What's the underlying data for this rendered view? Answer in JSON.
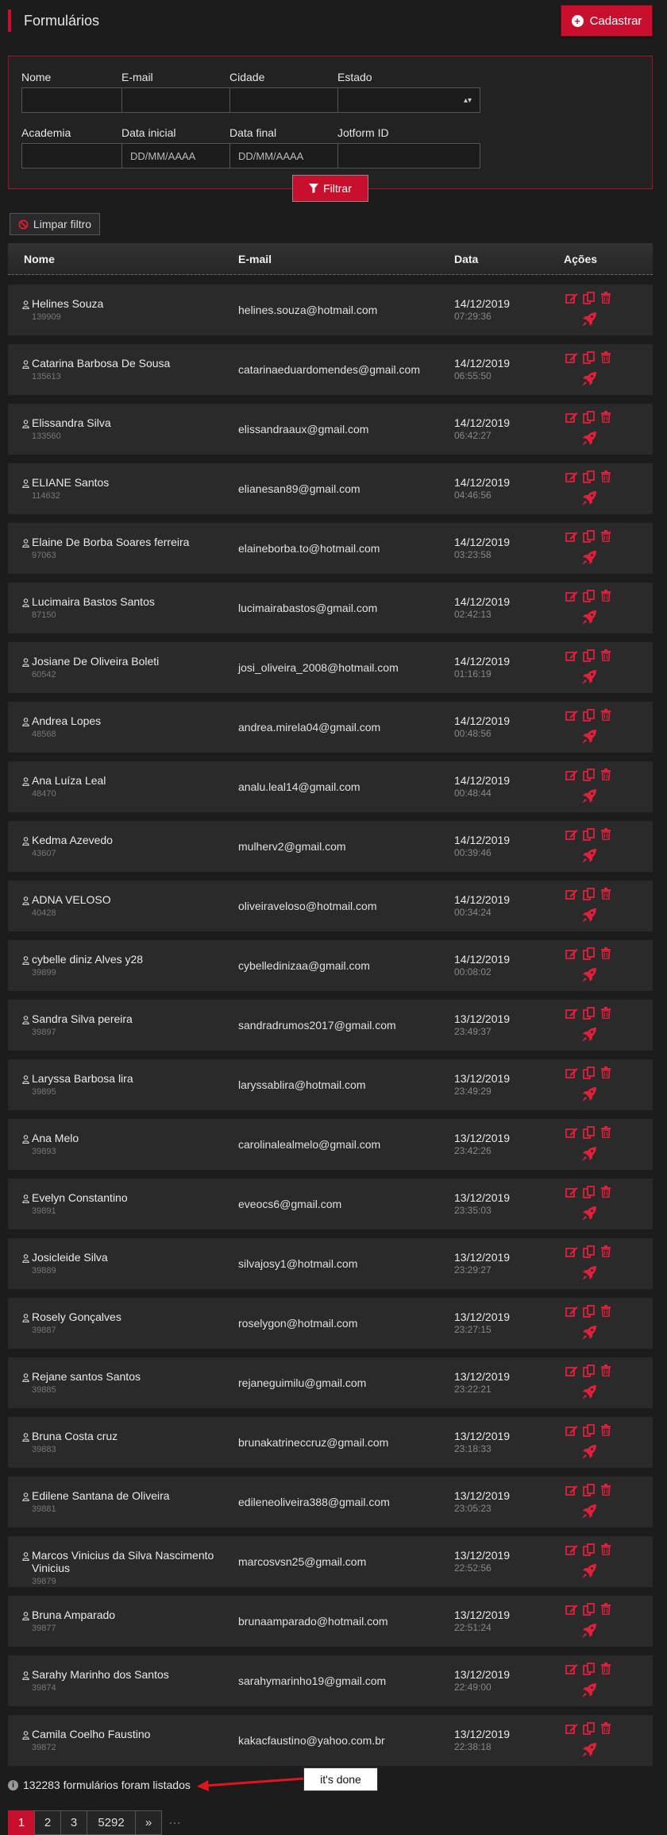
{
  "header": {
    "title": "Formulários",
    "cadastrar_label": "Cadastrar"
  },
  "filters": {
    "nome_label": "Nome",
    "nome_value": "",
    "email_label": "E-mail",
    "email_value": "",
    "cidade_label": "Cidade",
    "cidade_value": "",
    "estado_label": "Estado",
    "estado_value": "",
    "academia_label": "Academia",
    "academia_value": "",
    "data_inicial_label": "Data inicial",
    "data_inicial_placeholder": "DD/MM/AAAA",
    "data_final_label": "Data final",
    "data_final_placeholder": "DD/MM/AAAA",
    "jotform_label": "Jotform ID",
    "jotform_value": "",
    "filtrar_label": "Filtrar",
    "limpar_label": "Limpar filtro"
  },
  "table": {
    "headers": {
      "nome": "Nome",
      "email": "E-mail",
      "data": "Data",
      "acoes": "Ações"
    },
    "rows": [
      {
        "name": "Helines Souza",
        "id": "139909",
        "email": "helines.souza@hotmail.com",
        "date": "14/12/2019",
        "time": "07:29:36"
      },
      {
        "name": "Catarina Barbosa De Sousa",
        "id": "135613",
        "email": "catarinaeduardomendes@gmail.com",
        "date": "14/12/2019",
        "time": "06:55:50"
      },
      {
        "name": "Elissandra Silva",
        "id": "133560",
        "email": "elissandraaux@gmail.com",
        "date": "14/12/2019",
        "time": "06:42:27"
      },
      {
        "name": "ELIANE Santos",
        "id": "114632",
        "email": "elianesan89@gmail.com",
        "date": "14/12/2019",
        "time": "04:46:56"
      },
      {
        "name": "Elaine De Borba Soares ferreira",
        "id": "97063",
        "email": "elaineborba.to@hotmail.com",
        "date": "14/12/2019",
        "time": "03:23:58"
      },
      {
        "name": "Lucimaira Bastos Santos",
        "id": "87150",
        "email": "lucimairabastos@gmail.com",
        "date": "14/12/2019",
        "time": "02:42:13"
      },
      {
        "name": "Josiane De Oliveira Boleti",
        "id": "60542",
        "email": "josi_oliveira_2008@hotmail.com",
        "date": "14/12/2019",
        "time": "01:16:19"
      },
      {
        "name": "Andrea Lopes",
        "id": "48568",
        "email": "andrea.mirela04@gmail.com",
        "date": "14/12/2019",
        "time": "00:48:56"
      },
      {
        "name": "Ana Luíza Leal",
        "id": "48470",
        "email": "analu.leal14@gmail.com",
        "date": "14/12/2019",
        "time": "00:48:44"
      },
      {
        "name": "Kedma Azevedo",
        "id": "43607",
        "email": "mulherv2@gmail.com",
        "date": "14/12/2019",
        "time": "00:39:46"
      },
      {
        "name": "ADNA VELOSO",
        "id": "40428",
        "email": "oliveiraveloso@hotmail.com",
        "date": "14/12/2019",
        "time": "00:34:24"
      },
      {
        "name": "cybelle diniz Alves y28",
        "id": "39899",
        "email": "cybelledinizaa@gmail.com",
        "date": "14/12/2019",
        "time": "00:08:02"
      },
      {
        "name": "Sandra Silva pereira",
        "id": "39897",
        "email": "sandradrumos2017@gmail.com",
        "date": "13/12/2019",
        "time": "23:49:37"
      },
      {
        "name": "Laryssa Barbosa lira",
        "id": "39895",
        "email": "laryssablira@hotmail.com",
        "date": "13/12/2019",
        "time": "23:49:29"
      },
      {
        "name": "Ana Melo",
        "id": "39893",
        "email": "carolinalealmelo@gmail.com",
        "date": "13/12/2019",
        "time": "23:42:26"
      },
      {
        "name": "Evelyn Constantino",
        "id": "39891",
        "email": "eveocs6@gmail.com",
        "date": "13/12/2019",
        "time": "23:35:03"
      },
      {
        "name": "Josicleide Silva",
        "id": "39889",
        "email": "silvajosy1@hotmail.com",
        "date": "13/12/2019",
        "time": "23:29:27"
      },
      {
        "name": "Rosely Gonçalves",
        "id": "39887",
        "email": "roselygon@hotmail.com",
        "date": "13/12/2019",
        "time": "23:27:15"
      },
      {
        "name": "Rejane santos Santos",
        "id": "39885",
        "email": "rejaneguimilu@gmail.com",
        "date": "13/12/2019",
        "time": "23:22:21"
      },
      {
        "name": "Bruna Costa cruz",
        "id": "39883",
        "email": "brunakatrineccruz@gmail.com",
        "date": "13/12/2019",
        "time": "23:18:33"
      },
      {
        "name": "Edilene Santana de Oliveira",
        "id": "39881",
        "email": "edileneoliveira388@gmail.com",
        "date": "13/12/2019",
        "time": "23:05:23"
      },
      {
        "name": "Marcos Vinicius da Silva Nascimento Vinicius",
        "id": "39879",
        "email": "marcosvsn25@gmail.com",
        "date": "13/12/2019",
        "time": "22:52:56"
      },
      {
        "name": "Bruna Amparado",
        "id": "39877",
        "email": "brunaamparado@hotmail.com",
        "date": "13/12/2019",
        "time": "22:51:24"
      },
      {
        "name": "Sarahy Marinho dos Santos",
        "id": "39874",
        "email": "sarahymarinho19@gmail.com",
        "date": "13/12/2019",
        "time": "22:49:00"
      },
      {
        "name": "Camila Coelho Faustino",
        "id": "39872",
        "email": "kakacfaustino@yahoo.com.br",
        "date": "13/12/2019",
        "time": "22:38:18"
      }
    ]
  },
  "footer": {
    "count_text": "132283 formulários foram listados",
    "callout_text": "it's done"
  },
  "pagination": {
    "pages": [
      "1",
      "2",
      "3",
      "5292"
    ],
    "next_label": "»",
    "ellipsis": "···"
  },
  "colors": {
    "accent": "#c8102e",
    "background": "#1c1c1c",
    "row": "#2a2a2a"
  }
}
